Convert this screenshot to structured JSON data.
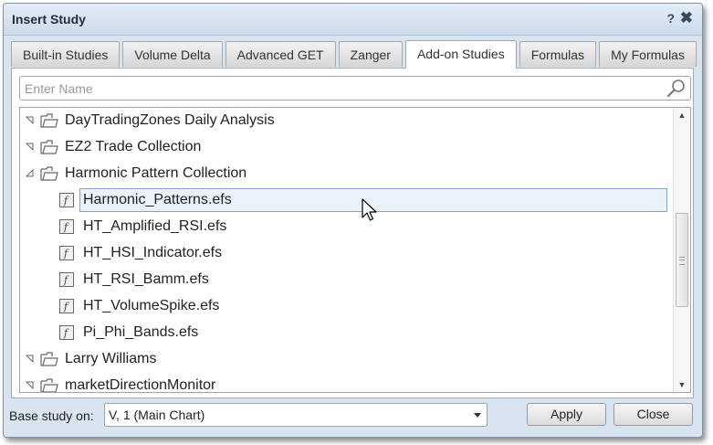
{
  "dialog": {
    "title": "Insert Study",
    "help_label": "?",
    "close_label": "✖"
  },
  "tabs": [
    {
      "label": "Built-in Studies",
      "active": false
    },
    {
      "label": "Volume Delta",
      "active": false
    },
    {
      "label": "Advanced GET",
      "active": false
    },
    {
      "label": "Zanger",
      "active": false
    },
    {
      "label": "Add-on Studies",
      "active": true
    },
    {
      "label": "Formulas",
      "active": false
    },
    {
      "label": "My Formulas",
      "active": false
    }
  ],
  "search": {
    "placeholder": "Enter Name",
    "value": ""
  },
  "tree": {
    "items": [
      {
        "type": "folder",
        "label": "DayTradingZones Daily Analysis",
        "expanded": false
      },
      {
        "type": "folder",
        "label": "EZ2 Trade Collection",
        "expanded": false
      },
      {
        "type": "folder",
        "label": "Harmonic Pattern Collection",
        "expanded": true
      },
      {
        "type": "file",
        "label": "Harmonic_Patterns.efs",
        "selected": true
      },
      {
        "type": "file",
        "label": "HT_Amplified_RSI.efs",
        "selected": false
      },
      {
        "type": "file",
        "label": "HT_HSI_Indicator.efs",
        "selected": false
      },
      {
        "type": "file",
        "label": "HT_RSI_Bamm.efs",
        "selected": false
      },
      {
        "type": "file",
        "label": "HT_VolumeSpike.efs",
        "selected": false
      },
      {
        "type": "file",
        "label": "Pi_Phi_Bands.efs",
        "selected": false
      },
      {
        "type": "folder",
        "label": "Larry Williams",
        "expanded": false
      },
      {
        "type": "folder",
        "label": "marketDirectionMonitor",
        "expanded": false
      }
    ]
  },
  "footer": {
    "base_label": "Base study on:",
    "base_value": "V, 1 (Main Chart)",
    "apply_label": "Apply",
    "close_label": "Close"
  },
  "icons": {
    "search": "search-icon",
    "folder": "folder-icon",
    "file": "formula-file-icon",
    "expand": "triangle-icon"
  }
}
